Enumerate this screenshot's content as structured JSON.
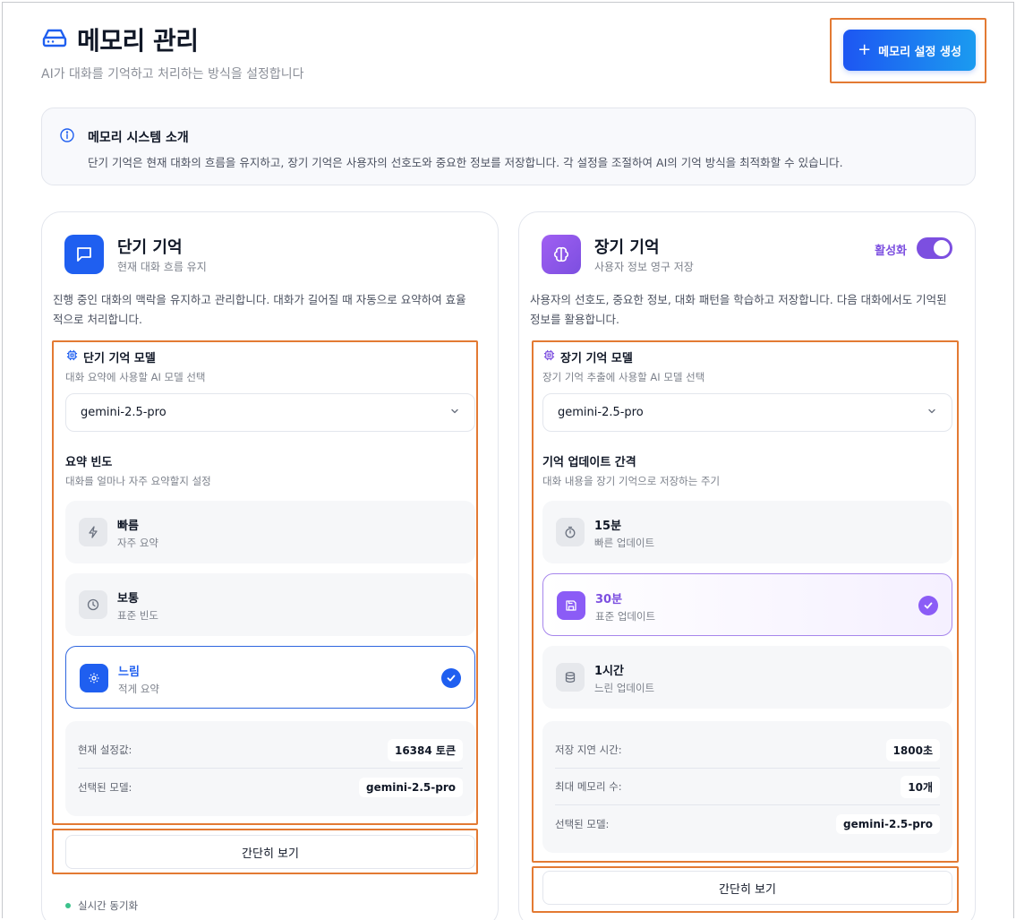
{
  "header": {
    "title": "메모리 관리",
    "subtitle": "AI가 대화를 기억하고 처리하는 방식을 설정합니다",
    "create_button": "메모리 설정 생성"
  },
  "intro": {
    "title": "메모리 시스템 소개",
    "description": "단기 기억은 현재 대화의 흐름을 유지하고, 장기 기억은 사용자의 선호도와 중요한 정보를 저장합니다. 각 설정을 조절하여 AI의 기억 방식을 최적화할 수 있습니다."
  },
  "short_term": {
    "title": "단기 기억",
    "subtitle": "현재 대화 흐름 유지",
    "description": "진행 중인 대화의 맥락을 유지하고 관리합니다. 대화가 길어질 때 자동으로 요약하여 효율적으로 처리합니다.",
    "model_title": "단기 기억 모델",
    "model_sub": "대화 요약에 사용할 AI 모델 선택",
    "model_value": "gemini-2.5-pro",
    "freq_title": "요약 빈도",
    "freq_sub": "대화를 얼마나 자주 요약할지 설정",
    "options": [
      {
        "label": "빠름",
        "sub": "자주 요약",
        "icon": "lightning-icon",
        "selected": false
      },
      {
        "label": "보통",
        "sub": "표준 빈도",
        "icon": "clock-icon",
        "selected": false
      },
      {
        "label": "느림",
        "sub": "적게 요약",
        "icon": "gear-icon",
        "selected": true
      }
    ],
    "summary": [
      {
        "label": "현재 설정값:",
        "value": "16384 토큰"
      },
      {
        "label": "선택된 모델:",
        "value": "gemini-2.5-pro"
      }
    ],
    "simple_view": "간단히 보기",
    "sync": "실시간 동기화"
  },
  "long_term": {
    "title": "장기 기억",
    "subtitle": "사용자 정보 영구 저장",
    "toggle_label": "활성화",
    "toggle_on": true,
    "description": "사용자의 선호도, 중요한 정보, 대화 패턴을 학습하고 저장합니다. 다음 대화에서도 기억된 정보를 활용합니다.",
    "model_title": "장기 기억 모델",
    "model_sub": "장기 기억 추출에 사용할 AI 모델 선택",
    "model_value": "gemini-2.5-pro",
    "interval_title": "기억 업데이트 간격",
    "interval_sub": "대화 내용을 장기 기억으로 저장하는 주기",
    "options": [
      {
        "label": "15분",
        "sub": "빠른 업데이트",
        "icon": "timer-icon",
        "selected": false
      },
      {
        "label": "30분",
        "sub": "표준 업데이트",
        "icon": "save-icon",
        "selected": true
      },
      {
        "label": "1시간",
        "sub": "느린 업데이트",
        "icon": "database-icon",
        "selected": false
      }
    ],
    "summary": [
      {
        "label": "저장 지연 시간:",
        "value": "1800초"
      },
      {
        "label": "최대 메모리 수:",
        "value": "10개"
      },
      {
        "label": "선택된 모델:",
        "value": "gemini-2.5-pro"
      }
    ],
    "simple_view": "간단히 보기"
  },
  "colors": {
    "primary_blue": "#1f5ff0",
    "purple": "#8b5cf6",
    "highlight": "#e37a33"
  }
}
